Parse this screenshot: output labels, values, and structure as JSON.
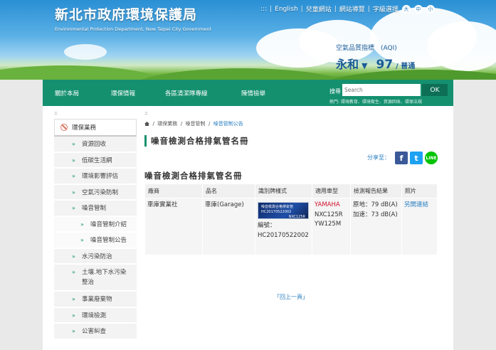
{
  "header": {
    "site_title": "新北市政府環境保護局",
    "site_subtitle": "Environmental Protection Department, New Taipei City Government",
    "top_links": [
      ":::",
      "English",
      "兒童網站",
      "網站導覽",
      "字級選擇"
    ],
    "font_sizes": [
      "大",
      "中",
      "小"
    ],
    "aqi_label": "空氣品質指標　(AQI)",
    "aqi_station": "永和",
    "aqi_value": "97",
    "aqi_status": "/ 普通"
  },
  "nav": {
    "items": [
      "關於本局",
      "環保情報",
      "各區清潔隊專線",
      "陳情檢舉"
    ],
    "search_label": "搜尋",
    "search_placeholder": "Search",
    "ok_label": "OK",
    "hot_keywords": "熱門: 環境教育、環境衛生、資源回收、環保法規"
  },
  "sidebar": {
    "dots": ":::",
    "heading": "環保業務",
    "items": [
      {
        "label": "資源回收",
        "sub": false
      },
      {
        "label": "低碳生活網",
        "sub": false
      },
      {
        "label": "環境影響評估",
        "sub": false
      },
      {
        "label": "空氣污染防制",
        "sub": false
      },
      {
        "label": "噪音管制",
        "sub": false
      },
      {
        "label": "噪音管制介紹",
        "sub": true
      },
      {
        "label": "噪音管制公告",
        "sub": true
      },
      {
        "label": "水污染防治",
        "sub": false
      },
      {
        "label": "土壤.地下水污染整治",
        "sub": false
      },
      {
        "label": "事業廢棄物",
        "sub": false
      },
      {
        "label": "環境檢測",
        "sub": false
      },
      {
        "label": "公害糾查",
        "sub": false
      }
    ]
  },
  "main": {
    "dots": ":::",
    "breadcrumb": [
      "環保業務",
      "噪音管制",
      "噪音管制公告"
    ],
    "page_title": "噪音檢測合格排氣管名冊",
    "share_label": "分享至：",
    "share_buttons": [
      "facebook-icon",
      "twitter-icon",
      "line-icon"
    ],
    "section_title": "噪音檢測合格排氣管名冊",
    "table": {
      "headers": [
        "廠商",
        "品名",
        "識別牌樣式",
        "適用車型",
        "檢測報告結果",
        "照片"
      ],
      "rows": [
        {
          "vendor": "車庫實業社",
          "product": "車庫(Garage)",
          "plate_line1": "噪音檢測合格排氣管",
          "plate_line2": "HC20170522002",
          "plate_line3": "NXC125R",
          "code_label": "編號：",
          "code_value": "HC20170522002",
          "brand": "YAMAHA",
          "model1": "NXC125R",
          "model2": "YW125M",
          "result1": "原地：79 dB(A)",
          "result2": "加速：73 dB(A)",
          "photo_link": "另開連結"
        }
      ]
    },
    "back_link": "「回上一頁」"
  },
  "colors": {
    "nav_green": "#14906f",
    "link_blue": "#2a7fc0",
    "brand_red": "#d0112b"
  }
}
